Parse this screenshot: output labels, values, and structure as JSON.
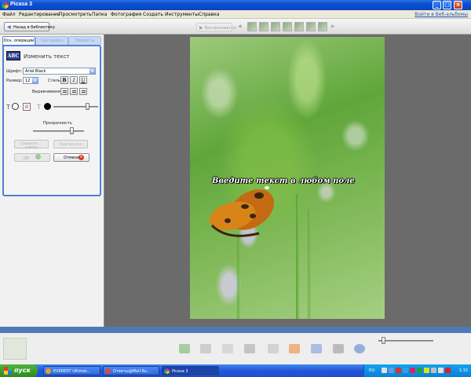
{
  "window": {
    "title": "Picasa 3"
  },
  "menu": {
    "items": [
      "Файл",
      "Редактирование",
      "Просмотреть",
      "Папка",
      "Фотография",
      "Создать",
      "Инструменты",
      "Справка"
    ],
    "signin": "Войти в Веб-альбомы"
  },
  "toolbar": {
    "back_label": "Назад в библиотеку",
    "play_label": "Воспроизвести"
  },
  "panel": {
    "tabs": [
      "Осн. операции",
      "Настройка",
      "Эффекты"
    ],
    "title": "Изменить текст",
    "font_label": "Шрифт:",
    "font_value": "Arial Black",
    "size_label": "Размер:",
    "size_value": "12",
    "style_label": "Стиль:",
    "bold": "B",
    "italic": "I",
    "underline": "U",
    "align_label": "Выравнивание:",
    "opacity_label": "Прозрачность",
    "opacity_level": 0.75,
    "outline_level": 0.75,
    "btn_save_template": "Сохранить ... шаблон",
    "btn_clear_all": "Очистить все",
    "ok_label": "ОК",
    "cancel_label": "Отмена"
  },
  "photo": {
    "caption": "Введите текст в любом поле"
  },
  "taskbar": {
    "start": "пуск",
    "tasks": [
      "EVEREST Ultimat...",
      "Ответы@Mail.Ru...",
      "Picasa 3"
    ],
    "lang": "RU",
    "clock": "1:15"
  },
  "colors": {
    "accent": "#4f7fd8",
    "cancel_icon": "#d23a2a",
    "text_color": "#000000",
    "fill_color": "#ffffff"
  }
}
